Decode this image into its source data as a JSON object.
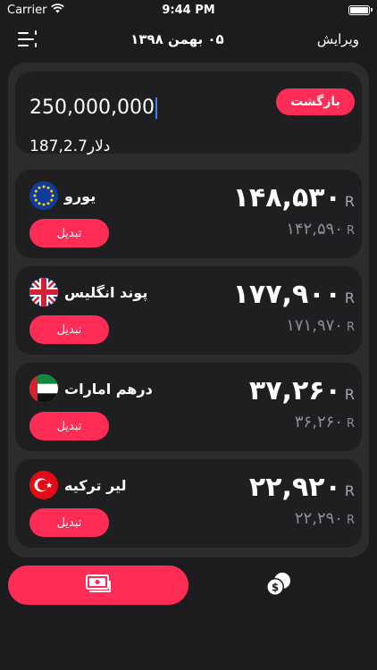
{
  "status": {
    "carrier": "Carrier",
    "time": "9:44 PM"
  },
  "nav": {
    "title": "۰۵ بهمن ۱۳۹۸",
    "edit_label": "ویرایش"
  },
  "converter": {
    "amount_value": "250,000,000",
    "dollar_text": "187,2.7دلار",
    "back_label": "بازگشت"
  },
  "currencies": [
    {
      "name": "یورو",
      "flag_icon": "eu-flag-icon",
      "price": "۱۴۸,۵۳۰",
      "unit": "R",
      "sub_price": "۱۴۲,۵۹۰",
      "sub_unit": "R",
      "convert_label": "تبدیل"
    },
    {
      "name": "پوند انگلیس",
      "flag_icon": "uk-flag-icon",
      "price": "۱۷۷,۹۰۰",
      "unit": "R",
      "sub_price": "۱۷۱,۹۷۰",
      "sub_unit": "R",
      "convert_label": "تبدیل"
    },
    {
      "name": "درهم امارات",
      "flag_icon": "uae-flag-icon",
      "price": "۳۷,۲۶۰",
      "unit": "R",
      "sub_price": "۳۶,۲۶۰",
      "sub_unit": "R",
      "convert_label": "تبدیل"
    },
    {
      "name": "لیر ترکیه",
      "flag_icon": "turkey-flag-icon",
      "price": "۲۲,۹۲۰",
      "unit": "R",
      "sub_price": "۲۲,۲۹۰",
      "sub_unit": "R",
      "convert_label": "تبدیل"
    }
  ],
  "tabs": [
    {
      "icon": "banknote-icon",
      "active": true
    },
    {
      "icon": "coins-icon",
      "active": false
    }
  ],
  "colors": {
    "accent": "#ff2d55",
    "background": "#1c1c1e",
    "panel": "#2c2c2e",
    "card": "#1f1f21",
    "caret": "#3b82f6"
  }
}
